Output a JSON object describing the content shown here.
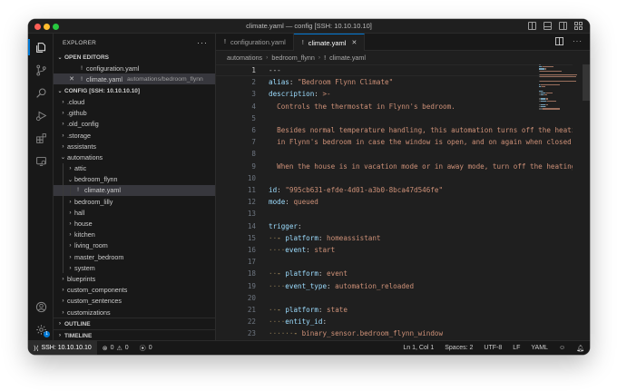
{
  "window": {
    "title": "climate.yaml — config [SSH: 10.10.10.10]"
  },
  "activity_bar": {
    "items": [
      "explorer-icon",
      "source-control-icon",
      "search-icon",
      "run-debug-icon",
      "extensions-icon",
      "remote-explorer-icon"
    ],
    "bottom": [
      "account-icon",
      "settings-gear-icon"
    ],
    "settings_badge": "1"
  },
  "sidebar": {
    "header": "EXPLORER",
    "open_editors": {
      "label": "OPEN EDITORS",
      "items": [
        {
          "name": "configuration.yaml",
          "path": ""
        },
        {
          "name": "climate.yaml",
          "path": "automations/bedroom_flynn"
        }
      ]
    },
    "workspace": {
      "label": "CONFIG [SSH: 10.10.10.10]",
      "tree": [
        {
          "label": ".cloud",
          "depth": 0,
          "folder": true,
          "expanded": false
        },
        {
          "label": ".github",
          "depth": 0,
          "folder": true,
          "expanded": false
        },
        {
          "label": ".old_config",
          "depth": 0,
          "folder": true,
          "expanded": false
        },
        {
          "label": ".storage",
          "depth": 0,
          "folder": true,
          "expanded": false
        },
        {
          "label": "assistants",
          "depth": 0,
          "folder": true,
          "expanded": false
        },
        {
          "label": "automations",
          "depth": 0,
          "folder": true,
          "expanded": true
        },
        {
          "label": "attic",
          "depth": 1,
          "folder": true,
          "expanded": false
        },
        {
          "label": "bedroom_flynn",
          "depth": 1,
          "folder": true,
          "expanded": true
        },
        {
          "label": "climate.yaml",
          "depth": 2,
          "folder": false,
          "selected": true
        },
        {
          "label": "bedroom_lilly",
          "depth": 1,
          "folder": true,
          "expanded": false
        },
        {
          "label": "hall",
          "depth": 1,
          "folder": true,
          "expanded": false
        },
        {
          "label": "house",
          "depth": 1,
          "folder": true,
          "expanded": false
        },
        {
          "label": "kitchen",
          "depth": 1,
          "folder": true,
          "expanded": false
        },
        {
          "label": "living_room",
          "depth": 1,
          "folder": true,
          "expanded": false
        },
        {
          "label": "master_bedroom",
          "depth": 1,
          "folder": true,
          "expanded": false
        },
        {
          "label": "system",
          "depth": 1,
          "folder": true,
          "expanded": false
        },
        {
          "label": "blueprints",
          "depth": 0,
          "folder": true,
          "expanded": false
        },
        {
          "label": "custom_components",
          "depth": 0,
          "folder": true,
          "expanded": false
        },
        {
          "label": "custom_sentences",
          "depth": 0,
          "folder": true,
          "expanded": false
        },
        {
          "label": "customizations",
          "depth": 0,
          "folder": true,
          "expanded": false
        }
      ]
    },
    "outline_label": "OUTLINE",
    "timeline_label": "TIMELINE"
  },
  "editor": {
    "tabs": [
      {
        "label": "configuration.yaml",
        "active": false
      },
      {
        "label": "climate.yaml",
        "active": true
      }
    ],
    "breadcrumbs": [
      "automations",
      "bedroom_flynn",
      "climate.yaml"
    ],
    "lines": [
      {
        "n": "1",
        "parts": [
          [
            "p",
            "---"
          ]
        ]
      },
      {
        "n": "2",
        "parts": [
          [
            "k",
            "alias"
          ],
          [
            "p",
            ": "
          ],
          [
            "s",
            "\"Bedroom Flynn Climate\""
          ]
        ]
      },
      {
        "n": "3",
        "parts": [
          [
            "k",
            "description"
          ],
          [
            "p",
            ": "
          ],
          [
            "s",
            ">-"
          ]
        ]
      },
      {
        "n": "4",
        "parts": [
          [
            "ind",
            "  "
          ],
          [
            "s",
            "Controls the thermostat in Flynn's bedroom."
          ]
        ]
      },
      {
        "n": "5",
        "parts": []
      },
      {
        "n": "6",
        "parts": [
          [
            "ind",
            "  "
          ],
          [
            "s",
            "Besides normal temperature handling, this automation turns off the heating"
          ]
        ]
      },
      {
        "n": "7",
        "parts": [
          [
            "ind",
            "  "
          ],
          [
            "s",
            "in Flynn's bedroom in case the window is open, and on again when closed."
          ]
        ]
      },
      {
        "n": "8",
        "parts": []
      },
      {
        "n": "9",
        "parts": [
          [
            "ind",
            "  "
          ],
          [
            "s",
            "When the house is in vacation mode or in away mode, turn off the heating."
          ]
        ]
      },
      {
        "n": "10",
        "parts": []
      },
      {
        "n": "11",
        "parts": [
          [
            "k",
            "id"
          ],
          [
            "p",
            ": "
          ],
          [
            "s",
            "\"995cb631-efde-4d01-a3b0-8bca47d546fe\""
          ]
        ]
      },
      {
        "n": "12",
        "parts": [
          [
            "k",
            "mode"
          ],
          [
            "p",
            ": "
          ],
          [
            "s",
            "queued"
          ]
        ]
      },
      {
        "n": "13",
        "parts": []
      },
      {
        "n": "14",
        "parts": [
          [
            "k",
            "trigger"
          ],
          [
            "p",
            ":"
          ]
        ]
      },
      {
        "n": "15",
        "parts": [
          [
            "ind",
            "··"
          ],
          [
            "blk",
            "- "
          ],
          [
            "k",
            "platform"
          ],
          [
            "p",
            ": "
          ],
          [
            "s",
            "homeassistant"
          ]
        ]
      },
      {
        "n": "16",
        "parts": [
          [
            "ind",
            "····"
          ],
          [
            "k",
            "event"
          ],
          [
            "p",
            ": "
          ],
          [
            "s",
            "start"
          ]
        ]
      },
      {
        "n": "17",
        "parts": []
      },
      {
        "n": "18",
        "parts": [
          [
            "ind",
            "··"
          ],
          [
            "blk",
            "- "
          ],
          [
            "k",
            "platform"
          ],
          [
            "p",
            ": "
          ],
          [
            "s",
            "event"
          ]
        ]
      },
      {
        "n": "19",
        "parts": [
          [
            "ind",
            "····"
          ],
          [
            "k",
            "event_type"
          ],
          [
            "p",
            ": "
          ],
          [
            "s",
            "automation_reloaded"
          ]
        ]
      },
      {
        "n": "20",
        "parts": []
      },
      {
        "n": "21",
        "parts": [
          [
            "ind",
            "··"
          ],
          [
            "blk",
            "- "
          ],
          [
            "k",
            "platform"
          ],
          [
            "p",
            ": "
          ],
          [
            "s",
            "state"
          ]
        ]
      },
      {
        "n": "22",
        "parts": [
          [
            "ind",
            "····"
          ],
          [
            "k",
            "entity_id"
          ],
          [
            "p",
            ":"
          ]
        ]
      },
      {
        "n": "23",
        "parts": [
          [
            "ind",
            "······"
          ],
          [
            "blk",
            "- "
          ],
          [
            "s",
            "binary_sensor.bedroom_flynn_window"
          ]
        ]
      }
    ]
  },
  "statusbar": {
    "remote": "SSH: 10.10.10.10",
    "errors": "0",
    "warnings": "0",
    "ports": "0",
    "position": "Ln 1, Col 1",
    "spaces": "Spaces: 2",
    "encoding": "UTF-8",
    "eol": "LF",
    "language": "YAML"
  },
  "colors": {
    "accent": "#0078d4",
    "key": "#9cdcfe",
    "string": "#ce9178",
    "background": "#1f1f1f"
  }
}
